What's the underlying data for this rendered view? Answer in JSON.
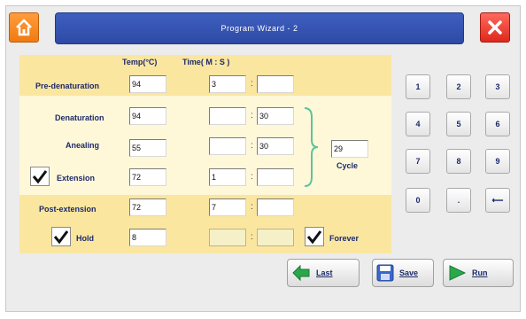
{
  "header": {
    "title": "Program Wizard - 2"
  },
  "columns": {
    "temp": "Temp(°C)",
    "time": "Time(  M  :  S  )"
  },
  "pre_denaturation": {
    "label": "Pre-denaturation",
    "temp": "94",
    "min": "3",
    "sec": ""
  },
  "denaturation": {
    "label": "Denaturation",
    "temp": "94",
    "min": "",
    "sec": "30"
  },
  "annealing": {
    "label": "Anealing",
    "temp": "55",
    "min": "",
    "sec": "30"
  },
  "extension": {
    "label": "Extension",
    "checked": true,
    "temp": "72",
    "min": "1",
    "sec": ""
  },
  "cycle": {
    "value": "29",
    "label": "Cycle"
  },
  "post_extension": {
    "label": "Post-extension",
    "temp": "72",
    "min": "7",
    "sec": ""
  },
  "hold": {
    "label": "Hold",
    "checked": true,
    "temp": "8",
    "min": "",
    "sec": ""
  },
  "forever": {
    "label": "Forever",
    "checked": true
  },
  "keypad": [
    "1",
    "2",
    "3",
    "4",
    "5",
    "6",
    "7",
    "8",
    "9",
    "0",
    ".",
    "⟵"
  ],
  "actions": {
    "last": "Last",
    "save": "Save",
    "run": "Run"
  },
  "colors": {
    "title_bar": "#2d4aa5",
    "band_strong": "#fbe6a0",
    "band_light": "#fff8d8",
    "home": "#f07a12",
    "close": "#e0281c"
  }
}
